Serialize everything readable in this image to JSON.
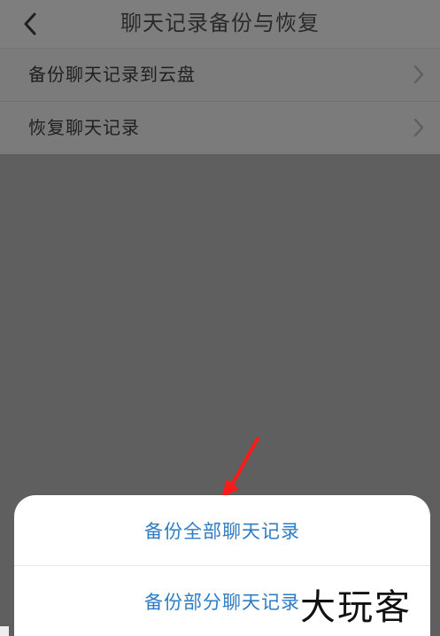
{
  "header": {
    "title": "聊天记录备份与恢复",
    "back_icon": "chevron-left-icon"
  },
  "settings": {
    "items": [
      {
        "label": "备份聊天记录到云盘",
        "icon": "chevron-right-icon"
      },
      {
        "label": "恢复聊天记录",
        "icon": "chevron-right-icon"
      }
    ]
  },
  "action_sheet": {
    "items": [
      {
        "label": "备份全部聊天记录"
      },
      {
        "label": "备份部分聊天记录"
      }
    ]
  },
  "watermark": {
    "text": "大玩客"
  },
  "colors": {
    "overlay": "#5f5f5f",
    "header": "#7e7e7e",
    "list": "#7b7b7b",
    "sheet_text": "#2f7cc3",
    "annotation_arrow": "#ff1a1a"
  }
}
